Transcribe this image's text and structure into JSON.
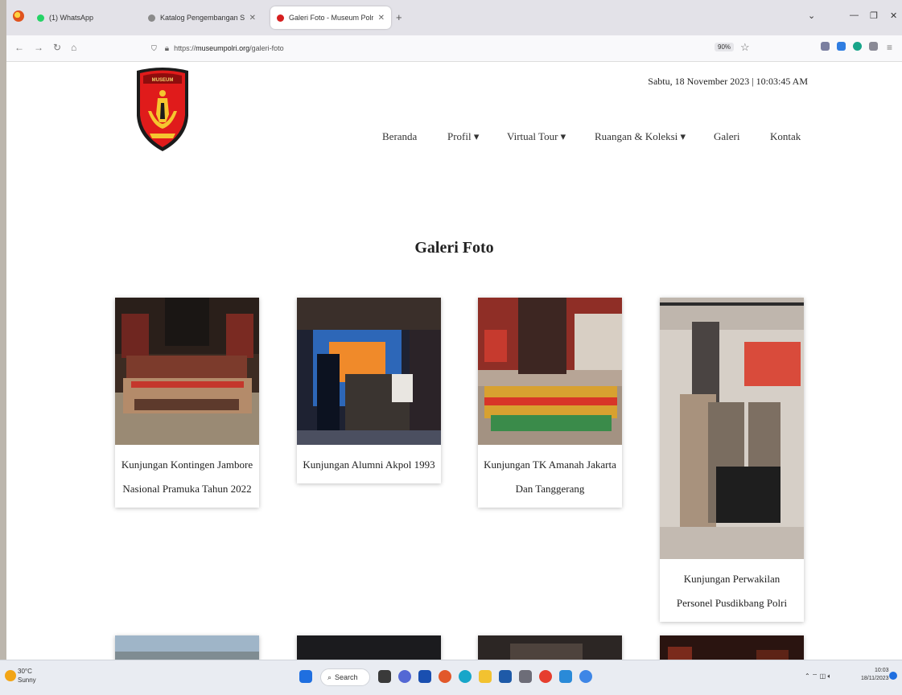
{
  "browser": {
    "tabs": [
      {
        "title": "(1) WhatsApp",
        "favicon_color": "#25d366"
      },
      {
        "title": "Katalog Pengembangan Sikap dan",
        "favicon_color": "#8a8a8a"
      },
      {
        "title": "Galeri Foto - Museum Polri",
        "favicon_color": "#d61f1f"
      }
    ],
    "url_prefix": "https://",
    "url_host": "museumpolri.org",
    "url_path": "/galeri-foto",
    "zoom": "90%",
    "nav_icons": [
      "back-icon",
      "forward-icon",
      "reload-icon",
      "home-icon"
    ]
  },
  "site": {
    "date": "Sabtu, 18 November 2023 | 10:03:45 AM",
    "menu": [
      "Beranda",
      "Profil ▾",
      "Virtual Tour ▾",
      "Ruangan & Koleksi ▾",
      "Galeri",
      "Kontak"
    ],
    "logo_text": "MUSEUM",
    "page_title": "Galeri Foto",
    "accent_color": "#e01b1b"
  },
  "gallery": [
    {
      "caption": "Kunjungan Kontingen Jambore Nasional Pramuka Tahun 2022"
    },
    {
      "caption": "Kunjungan Alumni Akpol 1993"
    },
    {
      "caption": "Kunjungan TK Amanah Jakarta Dan Tanggerang"
    },
    {
      "caption": "Kunjungan Perwakilan Personel Pusdikbang Polri"
    }
  ],
  "taskbar": {
    "weather_temp": "30°C",
    "weather_desc": "Sunny",
    "search": "Search",
    "time": "10:03",
    "date": "18/11/2023"
  }
}
